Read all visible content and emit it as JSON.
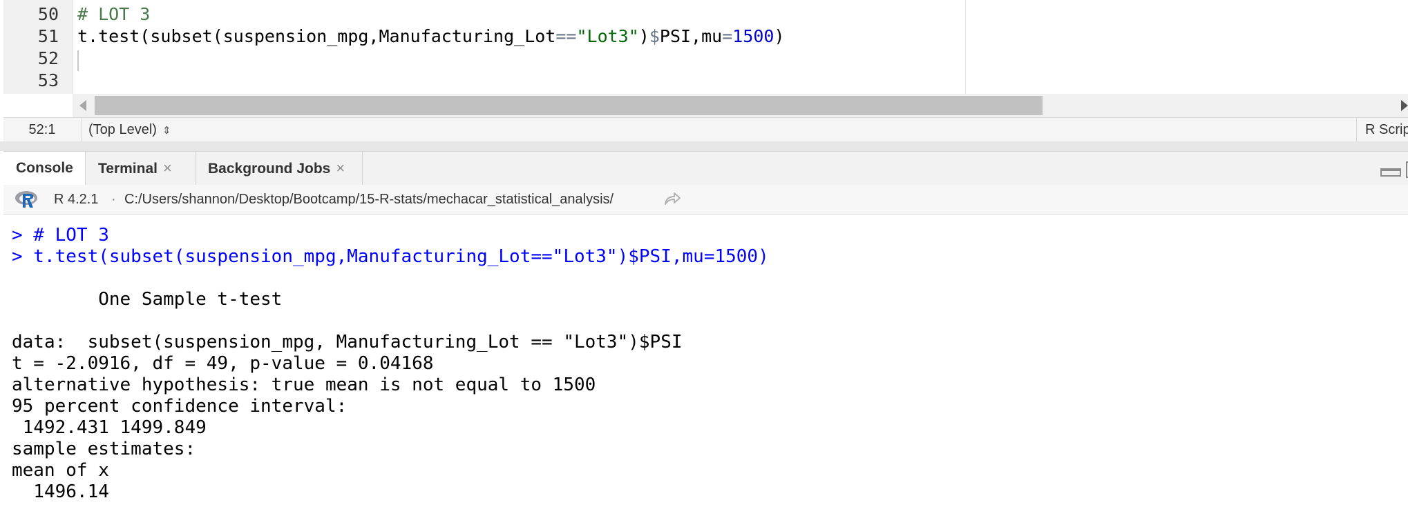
{
  "editor": {
    "line_numbers": [
      "50",
      "51",
      "52",
      "53"
    ],
    "lines": {
      "l50_comment": "# LOT 3",
      "l51": {
        "fn": "t.test(subset(suspension_mpg,Manufacturing_Lot",
        "eq": "==",
        "str": "\"Lot3\"",
        "mid": ")",
        "dollar": "$",
        "field": "PSI,mu",
        "assign": "=",
        "num": "1500",
        "close": ")"
      }
    },
    "status": {
      "position": "52:1",
      "scope": "(Top Level)",
      "scope_chevron": "⇕",
      "file_type": "R Script"
    }
  },
  "console": {
    "tabs": [
      {
        "label": "Console"
      },
      {
        "label": "Terminal",
        "close": "×"
      },
      {
        "label": "Background Jobs",
        "close": "×"
      }
    ],
    "r_version": "R 4.2.1",
    "separator": "·",
    "working_dir": "C:/Users/shannon/Desktop/Bootcamp/15-R-stats/mechacar_statistical_analysis/",
    "output": {
      "cmd1": "> # LOT 3",
      "cmd2": "> t.test(subset(suspension_mpg,Manufacturing_Lot==\"Lot3\")$PSI,mu=1500)",
      "title": "        One Sample t-test",
      "data_line": "data:  subset(suspension_mpg, Manufacturing_Lot == \"Lot3\")$PSI",
      "stats_line": "t = -2.0916, df = 49, p-value = 0.04168",
      "alt_line": "alternative hypothesis: true mean is not equal to 1500",
      "ci_label": "95 percent confidence interval:",
      "ci_values": " 1492.431 1499.849",
      "est_label": "sample estimates:",
      "mean_label": "mean of x",
      "mean_value": "  1496.14"
    }
  },
  "colors": {
    "comment": "#4a7a4a",
    "string": "#036a07",
    "number": "#0000cd",
    "console_command": "#0000ff",
    "r_logo_blue": "#2165b6",
    "r_logo_grey": "#9c9ea3"
  },
  "icons": {
    "r_logo": "r-logo-icon",
    "goto_dir": "share-arrow-icon",
    "minimize": "minimize-icon",
    "maximize": "maximize-icon"
  }
}
